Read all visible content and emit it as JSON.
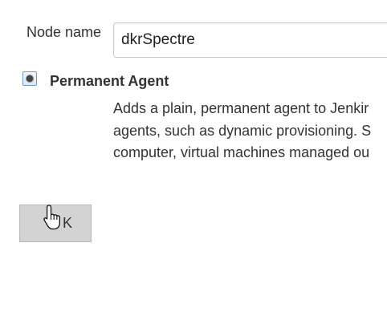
{
  "form": {
    "node_name_label": "Node name",
    "node_name_value": "dkrSpectre"
  },
  "agent_option": {
    "title": "Permanent Agent",
    "selected": true,
    "description_lines": [
      "Adds a plain, permanent agent to Jenkir",
      "agents, such as dynamic provisioning. S",
      "computer, virtual machines managed ou"
    ]
  },
  "actions": {
    "ok_label": "K"
  },
  "cursor": {
    "icon": "hand-pointer-icon"
  }
}
